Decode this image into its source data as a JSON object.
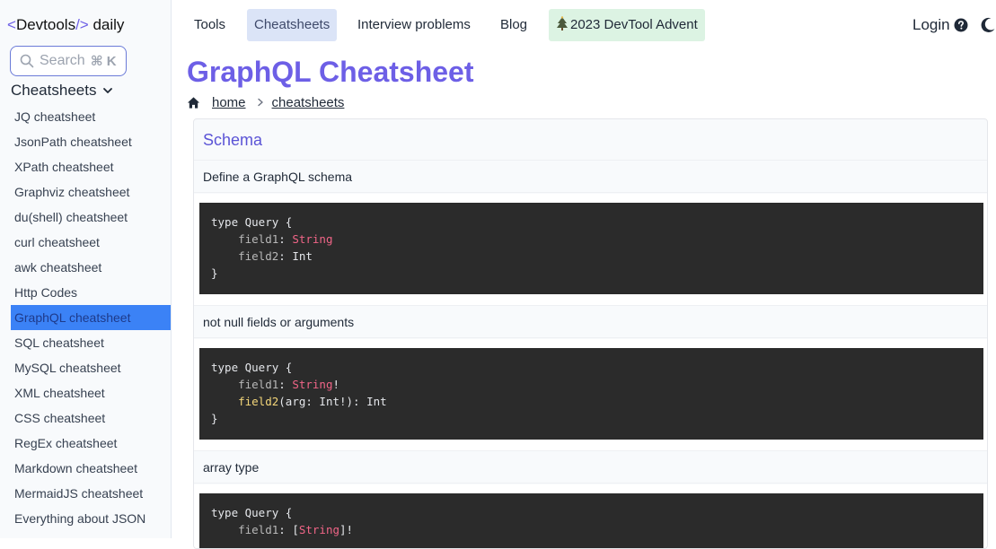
{
  "sidebar": {
    "logo": {
      "open": "<",
      "name": "Devtools",
      "close": "/>",
      "suffix": "daily"
    },
    "search": {
      "placeholder": "Search",
      "shortcut": "⌘ K"
    },
    "section_label": "Cheatsheets",
    "items": [
      {
        "label": "JQ cheatsheet",
        "active": false
      },
      {
        "label": "JsonPath cheatsheet",
        "active": false
      },
      {
        "label": "XPath cheatsheet",
        "active": false
      },
      {
        "label": "Graphviz cheatsheet",
        "active": false
      },
      {
        "label": "du(shell) cheatsheet",
        "active": false
      },
      {
        "label": "curl cheatsheet",
        "active": false
      },
      {
        "label": "awk cheatsheet",
        "active": false
      },
      {
        "label": "Http Codes",
        "active": false
      },
      {
        "label": "GraphQL cheatsheet",
        "active": true
      },
      {
        "label": "SQL cheatsheet",
        "active": false
      },
      {
        "label": "MySQL cheatsheet",
        "active": false
      },
      {
        "label": "XML cheatsheet",
        "active": false
      },
      {
        "label": "CSS cheatsheet",
        "active": false
      },
      {
        "label": "RegEx cheatsheet",
        "active": false
      },
      {
        "label": "Markdown cheatsheet",
        "active": false
      },
      {
        "label": "MermaidJS cheatsheet",
        "active": false
      },
      {
        "label": "Everything about JSON",
        "active": false
      }
    ]
  },
  "topnav": {
    "tabs": [
      {
        "label": "Tools"
      },
      {
        "label": "Cheatsheets"
      },
      {
        "label": "Interview problems"
      },
      {
        "label": "Blog"
      },
      {
        "label": "2023 DevTool Advent"
      }
    ],
    "login": "Login"
  },
  "page": {
    "title": "GraphQL Cheatsheet",
    "breadcrumb": [
      "home",
      "cheatsheets"
    ]
  },
  "card": {
    "title": "Schema",
    "sections": [
      {
        "label": "Define a GraphQL schema"
      },
      {
        "label": "not null fields or arguments"
      },
      {
        "label": "array type"
      }
    ]
  },
  "code": {
    "b1": {
      "l1": "type Query {",
      "l2_field": "field1",
      "l2_colon": ": ",
      "l2_type": "String",
      "l3_field": "field2",
      "l3_rest": ": Int",
      "l4": "}"
    },
    "b2": {
      "l1": "type Query {",
      "l2_field": "field1",
      "l2_colon": ": ",
      "l2_type": "String",
      "l2_bang": "!",
      "l3_fn": "field2",
      "l3_rest": "(arg: Int!): Int",
      "l4": "}"
    },
    "b3": {
      "l1": "type Query {",
      "l2_field": "field1",
      "l2_open": ": [",
      "l2_type": "String",
      "l2_close": "]!"
    }
  },
  "colors": {
    "accent": "#6d5fe6",
    "active_sidebar": "#3b82f6",
    "code_bg": "#2b2b2b",
    "code_type": "#f06587",
    "code_fn": "#f5d77a"
  }
}
